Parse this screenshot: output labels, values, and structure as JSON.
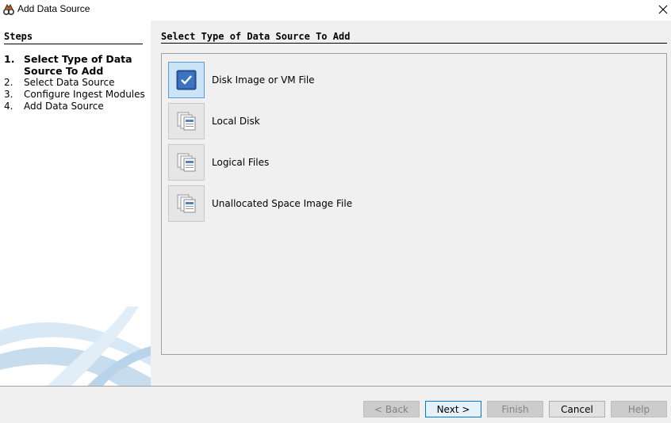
{
  "window": {
    "title": "Add Data Source"
  },
  "steps": {
    "header": "Steps",
    "items": [
      {
        "num": "1.",
        "label": "Select Type of Data Source To Add",
        "active": true
      },
      {
        "num": "2.",
        "label": "Select Data Source",
        "active": false
      },
      {
        "num": "3.",
        "label": "Configure Ingest Modules",
        "active": false
      },
      {
        "num": "4.",
        "label": "Add Data Source",
        "active": false
      }
    ]
  },
  "main": {
    "header": "Select Type of Data Source To Add",
    "options": [
      {
        "label": "Disk Image or VM File",
        "icon": "checkbox-icon",
        "selected": true
      },
      {
        "label": "Local Disk",
        "icon": "document-stack-icon",
        "selected": false
      },
      {
        "label": "Logical Files",
        "icon": "document-stack-icon",
        "selected": false
      },
      {
        "label": "Unallocated Space Image File",
        "icon": "document-stack-icon",
        "selected": false
      }
    ]
  },
  "buttons": {
    "back": "< Back",
    "next": "Next >",
    "finish": "Finish",
    "cancel": "Cancel",
    "help": "Help"
  },
  "colors": {
    "selection_accent": "#5b9bd5",
    "selection_fill": "#cce4f7",
    "panel_bg": "#f0f0f0"
  }
}
